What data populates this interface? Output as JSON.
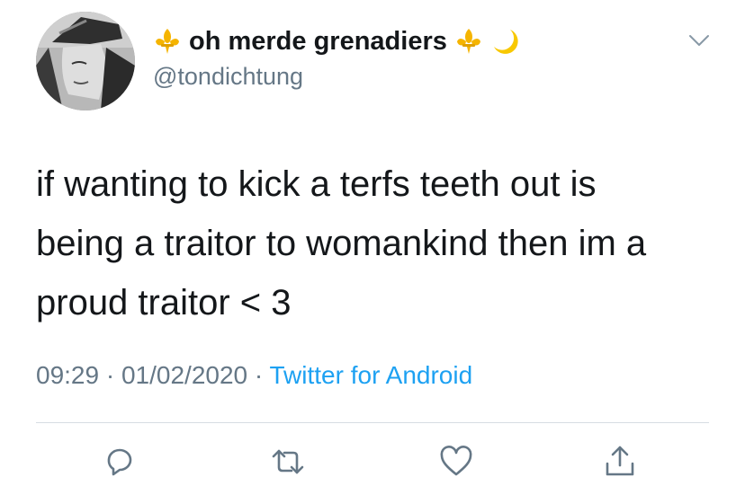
{
  "user": {
    "display_name": "oh merde grenadiers",
    "handle": "@tondichtung",
    "name_emojis": [
      "fleur-de-lis-icon",
      "fleur-de-lis-icon",
      "crescent-moon-icon"
    ],
    "avatar": "grayscale illustrated portrait"
  },
  "tweet": {
    "lines": [
      "if wanting to kick a terfs teeth out is",
      "being a traitor to womankind then im a",
      "proud traitor < 3"
    ],
    "time": "09:29",
    "date": "01/02/2020",
    "separator": "·",
    "source": "Twitter for Android"
  },
  "actions": [
    "reply-icon",
    "retweet-icon",
    "like-icon",
    "share-icon"
  ],
  "colors": {
    "text": "#14171a",
    "secondary": "#657786",
    "link": "#1da1f2",
    "divider": "#d7dde2",
    "emoji_gold": "#f5b400"
  }
}
